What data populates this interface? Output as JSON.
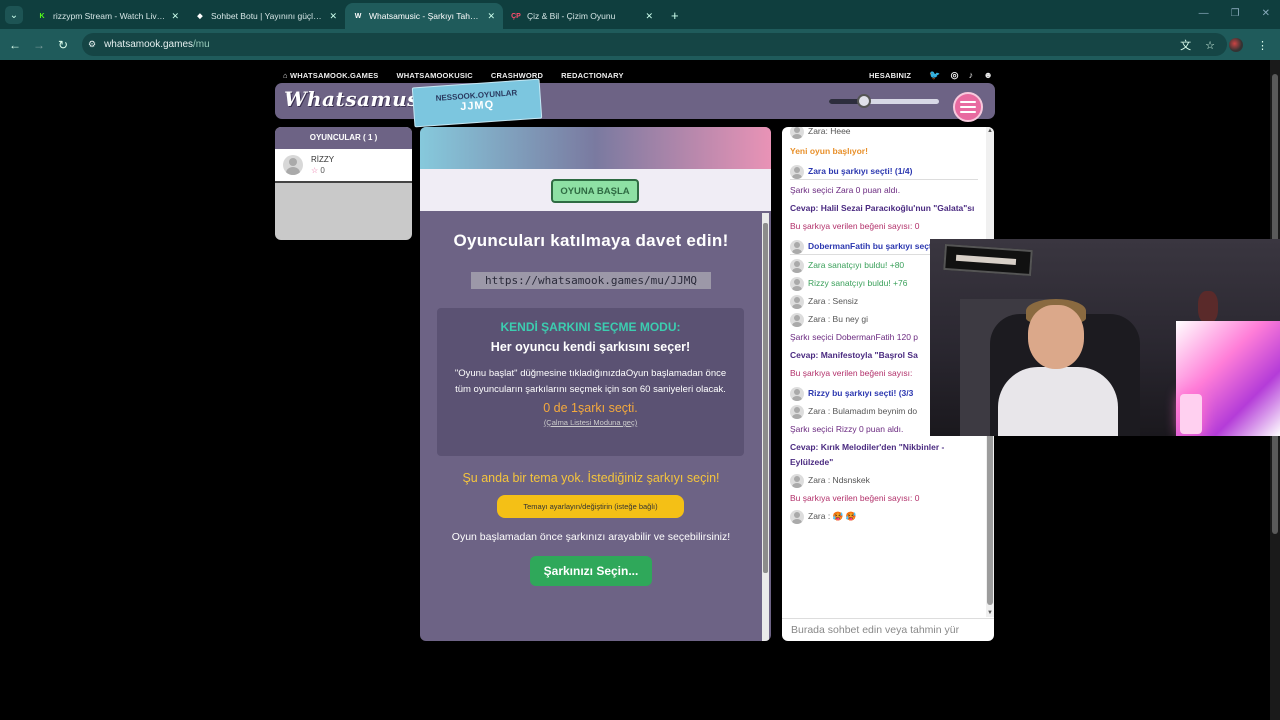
{
  "browser": {
    "tabs": [
      {
        "title": "rizzypm Stream - Watch Live on",
        "favicon": "K",
        "fav_color": "#53fc18",
        "active": false
      },
      {
        "title": "Sohbet Botu | Yayınını güçlendir",
        "favicon": "◆",
        "fav_color": "#ffffff",
        "active": false
      },
      {
        "title": "Whatsamusic - Şarkıyı Tahmin E",
        "favicon": "W",
        "fav_color": "#ffffff",
        "active": true
      },
      {
        "title": "Çiz & Bil - Çizim Oyunu",
        "favicon": "ÇP",
        "fav_color": "#ff4d6d",
        "active": false
      }
    ],
    "url_host": "whatsamook.games",
    "url_path": "/mu"
  },
  "site": {
    "nav": [
      "WHATSAMOOK.GAMES",
      "WHATSAMOOKUSIC",
      "CRASHWORD",
      "REDACTIONARY"
    ],
    "account": "HESABINIZ",
    "logo": "Whatsamusic",
    "room_line1": "NESSOOK.OYUNLAR",
    "room_code": "JJMQ",
    "volume_level": 0.32
  },
  "players": {
    "header": "OYUNCULAR ( 1 )",
    "list": [
      {
        "name": "RİZZY",
        "score": "0"
      }
    ]
  },
  "game": {
    "start_button": "OYUNA BAŞLA",
    "invite_title": "Oyuncuları katılmaya davet edin!",
    "invite_url": "https://whatsamook.games/mu/JJMQ",
    "mode_title": "KENDİ ŞARKINI SEÇME MODU:",
    "mode_subtitle": "Her oyuncu kendi şarkısını seçer!",
    "mode_desc": "\"Oyunu başlat\" düğmesine tıkladığınızdaOyun başlamadan önce tüm oyuncuların şarkılarını seçmek için son 60 saniyeleri olacak.",
    "mode_count": "0 de 1şarkı seçti.",
    "mode_link": "(Çalma Listesi Moduna geç)",
    "theme_msg": "Şu anda bir tema yok. İstediğiniz şarkıyı seçin!",
    "theme_button": "Temayı ayarlayın/değiştirin (isteğe bağlı)",
    "search_msg": "Oyun başlamadan önce şarkınızı arayabilir ve seçebilirsiniz!",
    "pick_button": "Şarkınızı Seçin..."
  },
  "chat": {
    "messages": [
      {
        "avatar": true,
        "text": "Zara: Heee",
        "style": "c-gray"
      },
      {
        "avatar": false,
        "text": "Yeni oyun başlıyor!",
        "style": "c-orange"
      },
      {
        "avatar": true,
        "text": "Zara bu şarkıyı seçti! (1/4)",
        "style": "c-blue"
      },
      {
        "avatar": false,
        "text": "Şarkı seçici Zara 0 puan aldı.",
        "style": "c-purple"
      },
      {
        "avatar": false,
        "text": "Cevap: Halil Sezai Paracıkoğlu'nun \"Galata\"sı",
        "style": "c-purplebold"
      },
      {
        "avatar": false,
        "text": "Bu şarkıya verilen beğeni sayısı: 0",
        "style": "c-pink"
      },
      {
        "avatar": true,
        "text": "DobermanFatih bu şarkıyı seçti! (2/3)",
        "style": "c-blue"
      },
      {
        "avatar": true,
        "text": "Zara sanatçıyı buldu! +80",
        "style": "c-green"
      },
      {
        "avatar": true,
        "text": "Rizzy sanatçıyı buldu! +76",
        "style": "c-green"
      },
      {
        "avatar": true,
        "text": "Zara : Sensiz",
        "style": "c-gray"
      },
      {
        "avatar": true,
        "text": "Zara : Bu ney gi",
        "style": "c-gray"
      },
      {
        "avatar": false,
        "text": "Şarkı seçici DobermanFatih 120 p",
        "style": "c-purple"
      },
      {
        "avatar": false,
        "text": "Cevap: Manifestoyla \"Başrol Sa",
        "style": "c-purplebold"
      },
      {
        "avatar": false,
        "text": "Bu şarkıya verilen beğeni sayısı: ",
        "style": "c-pink"
      },
      {
        "avatar": true,
        "text": "Rizzy bu şarkıyı seçti! (3/3",
        "style": "c-blue"
      },
      {
        "avatar": true,
        "text": "Zara : Bulamadım beynim do",
        "style": "c-gray"
      },
      {
        "avatar": false,
        "text": "Şarkı seçici Rizzy 0 puan aldı.",
        "style": "c-purple"
      },
      {
        "avatar": false,
        "text": "Cevap: Kırık Melodiler'den \"Nikbinler - Eylülzede\"",
        "style": "c-purplebold"
      },
      {
        "avatar": true,
        "text": "Zara : Ndsnskek",
        "style": "c-gray"
      },
      {
        "avatar": false,
        "text": "Bu şarkıya verilen beğeni sayısı: 0",
        "style": "c-pink"
      },
      {
        "avatar": true,
        "text": "Zara : 🥵 🥵",
        "style": "c-gray"
      }
    ],
    "input_placeholder": "Burada sohbet edin veya tahmin yür"
  }
}
